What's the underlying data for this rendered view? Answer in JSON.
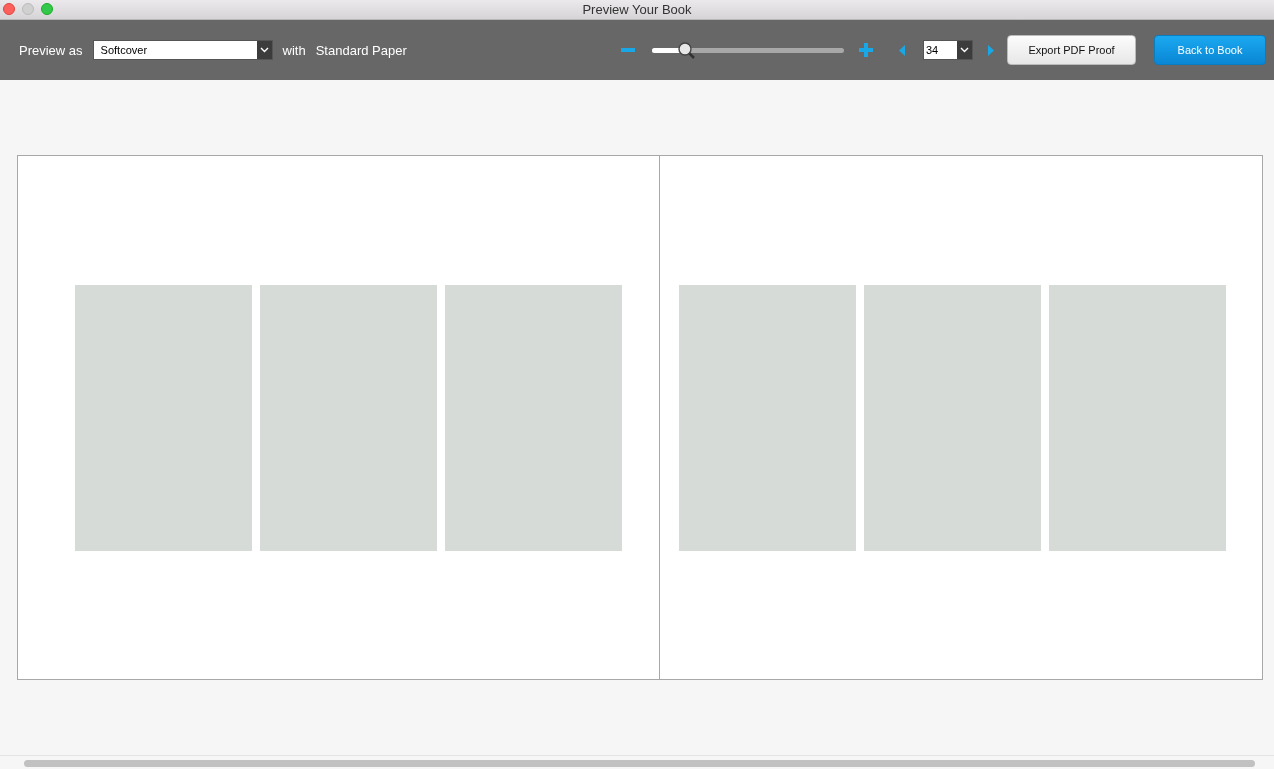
{
  "window": {
    "title": "Preview Your Book"
  },
  "toolbar": {
    "preview_label": "Preview as",
    "binding": {
      "value": "Softcover"
    },
    "with_label": "with",
    "paper": "Standard Paper",
    "zoom": {
      "level": 0.17
    },
    "page": {
      "value": "34"
    },
    "buttons": [
      {
        "label": "Export PDF Proof",
        "kind": "secondary"
      },
      {
        "label": "Back to Book",
        "kind": "primary"
      }
    ]
  },
  "spread": {
    "pages": [
      {
        "slots": [
          {
            "kind": "placeholder"
          },
          {
            "kind": "placeholder"
          },
          {
            "kind": "placeholder"
          }
        ]
      },
      {
        "slots": [
          {
            "kind": "placeholder"
          },
          {
            "kind": "placeholder"
          },
          {
            "kind": "placeholder"
          }
        ]
      }
    ]
  }
}
